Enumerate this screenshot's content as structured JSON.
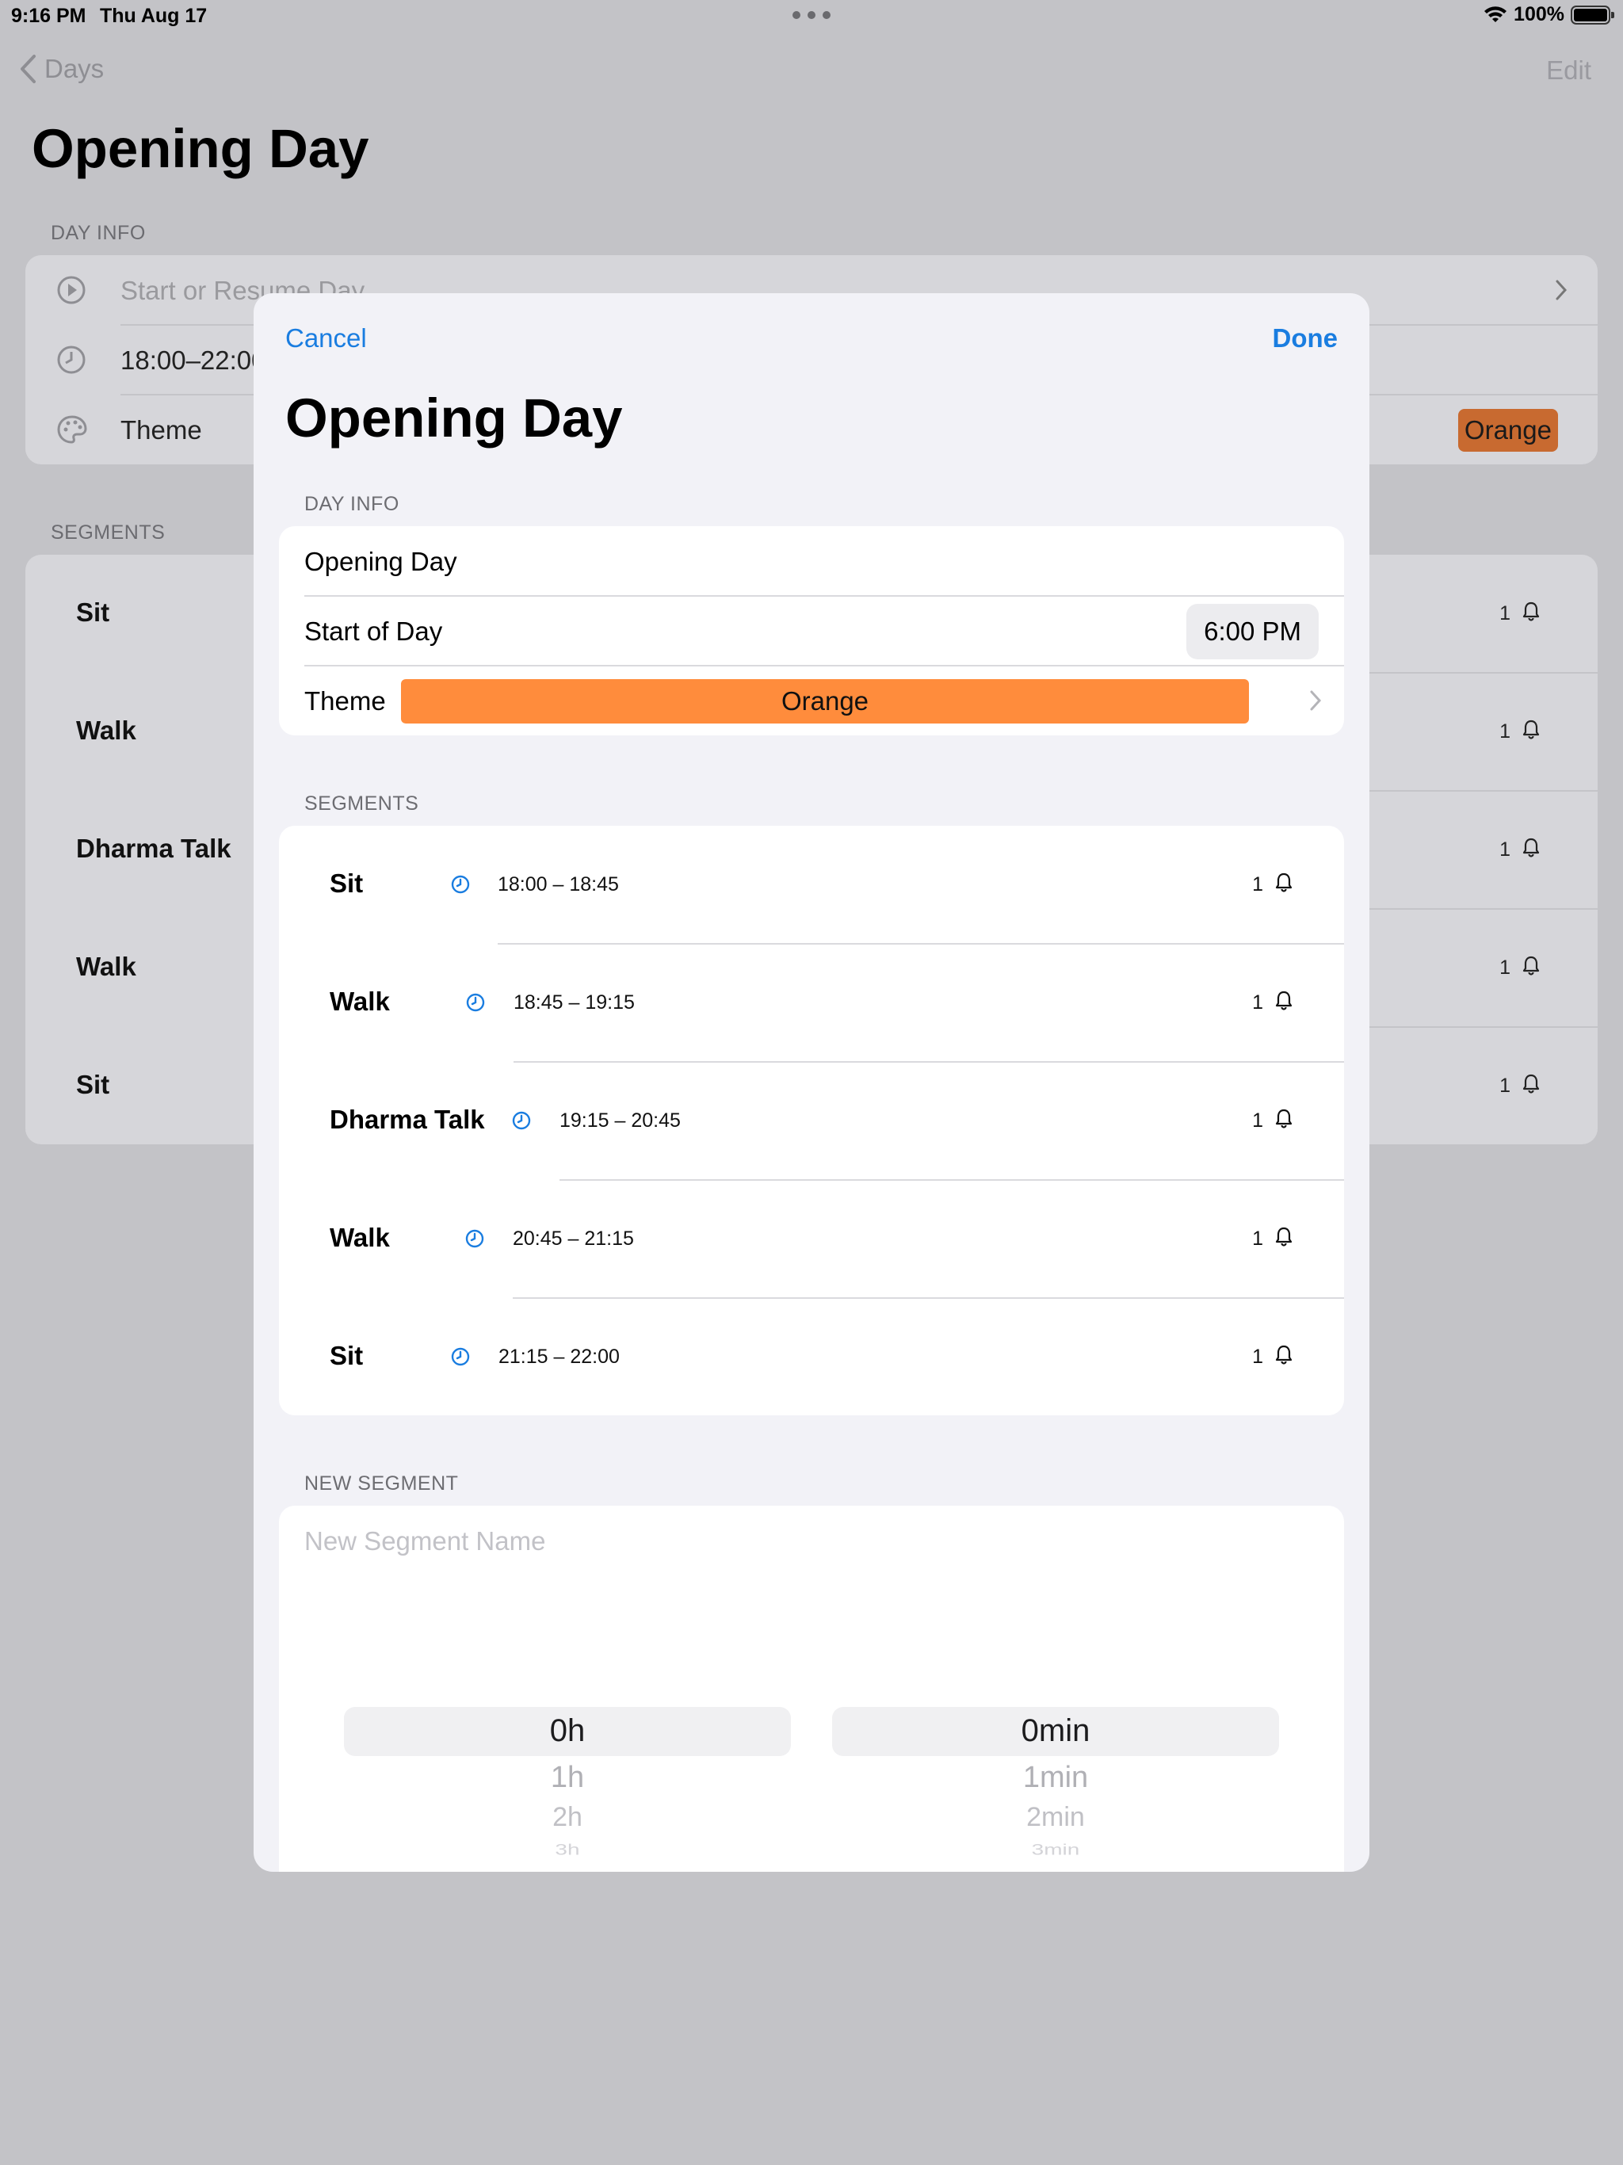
{
  "status_bar": {
    "time": "9:16 PM",
    "date": "Thu Aug 17",
    "battery": "100%"
  },
  "background": {
    "back_label": "Days",
    "edit_label": "Edit",
    "title": "Opening Day",
    "day_info_header": "DAY INFO",
    "rows": {
      "start": "Start or Resume Day",
      "time": "18:00–22:00",
      "theme": "Theme",
      "theme_value": "Orange"
    },
    "segments_header": "SEGMENTS",
    "segments": [
      {
        "name": "Sit",
        "bells": "1"
      },
      {
        "name": "Walk",
        "bells": "1"
      },
      {
        "name": "Dharma Talk",
        "bells": "1"
      },
      {
        "name": "Walk",
        "bells": "1"
      },
      {
        "name": "Sit",
        "bells": "1"
      }
    ]
  },
  "modal": {
    "cancel": "Cancel",
    "done": "Done",
    "title": "Opening Day",
    "day_info_header": "DAY INFO",
    "day_name": "Opening Day",
    "start_label": "Start of Day",
    "start_value": "6:00 PM",
    "theme_label": "Theme",
    "theme_value": "Orange",
    "theme_color": "#ff8c3c",
    "segments_header": "SEGMENTS",
    "segments": [
      {
        "name": "Sit",
        "time": "18:00 – 18:45",
        "bells": "1"
      },
      {
        "name": "Walk",
        "time": "18:45 – 19:15",
        "bells": "1"
      },
      {
        "name": "Dharma Talk",
        "time": "19:15 – 20:45",
        "bells": "1"
      },
      {
        "name": "Walk",
        "time": "20:45 – 21:15",
        "bells": "1"
      },
      {
        "name": "Sit",
        "time": "21:15 – 22:00",
        "bells": "1"
      }
    ],
    "new_segment_header": "NEW SEGMENT",
    "new_segment_placeholder": "New Segment Name",
    "hours_picker": [
      "0h",
      "1h",
      "2h",
      "3h"
    ],
    "minutes_picker": [
      "0min",
      "1min",
      "2min",
      "3min"
    ]
  },
  "colors": {
    "accent": "#1a7de0",
    "theme_orange": "#ff8c3c"
  }
}
